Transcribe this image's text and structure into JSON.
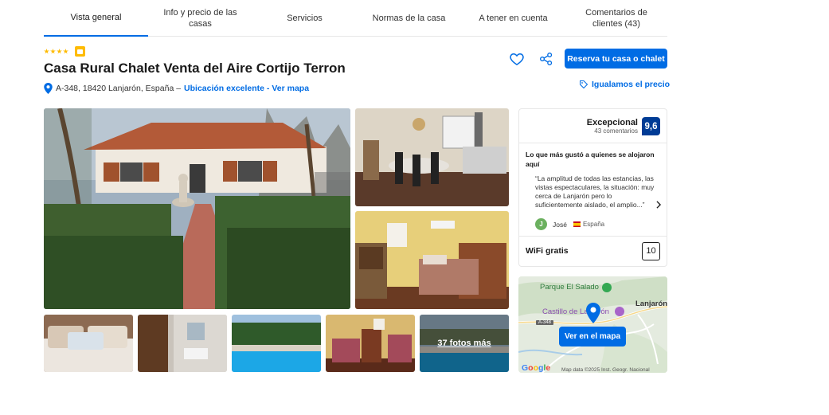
{
  "tabs": [
    {
      "label": "Vista general",
      "active": true
    },
    {
      "label": "Info y precio de las casas"
    },
    {
      "label": "Servicios"
    },
    {
      "label": "Normas de la casa"
    },
    {
      "label": "A tener en cuenta"
    },
    {
      "label": "Comentarios de clientes (43)"
    }
  ],
  "property": {
    "stars": 4,
    "title": "Casa Rural Chalet Venta del Aire Cortijo Terron",
    "address": "A-348, 18420 Lanjarón, España –",
    "location_link": "Ubicación excelente - Ver mapa"
  },
  "actions": {
    "favorite_icon": "heart-icon",
    "share_icon": "share-icon",
    "reserve_label": "Reserva tu casa o chalet",
    "price_match_label": "Igualamos el precio"
  },
  "gallery": {
    "more_photos_label": "37 fotos más"
  },
  "review": {
    "score_word": "Excepcional",
    "count": "43 comentarios",
    "score": "9,6",
    "liked_heading": "Lo que más gustó a quienes se alojaron aquí",
    "quote": "“La amplitud de todas las estancias, las vistas espectaculares, la situación: muy cerca de Lanjarón pero lo suficientemente aislado, el amplio...”",
    "reviewer_initial": "J",
    "reviewer_name": "José",
    "reviewer_country": "España",
    "wifi_label": "WiFi gratis",
    "wifi_score": "10"
  },
  "map": {
    "label_park": "Parque El Salado",
    "label_castle": "Castillo de Lanjarón",
    "label_town": "Lanjarón",
    "road": "A-348",
    "button_label": "Ver en el mapa",
    "attribution": "Map data ©2025 Inst. Geogr. Nacional",
    "google_letters": [
      "G",
      "o",
      "o",
      "g",
      "l",
      "e"
    ]
  },
  "colors": {
    "primary": "#006ce4",
    "score_badge": "#003b95",
    "stars": "#febb02"
  }
}
